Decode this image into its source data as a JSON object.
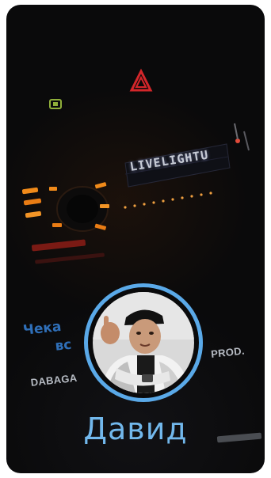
{
  "story": {
    "name": "Давид",
    "radio_display": "LIVELIGHTU",
    "lyrics_line1": "Чека",
    "lyrics_line2": "вс",
    "credit_left": "DABAGA",
    "credit_right": "PROD."
  },
  "colors": {
    "ring": "#5aa9e8",
    "name": "#72b8ec",
    "card_bg": "#0a0a0b",
    "amber_leds": "#f08a1a",
    "hazard_red": "#d3262a",
    "lyrics_blue": "#2f6fb8"
  },
  "icons": {
    "hazard": "hazard-warning-icon",
    "seatbelt": "seatbelt-indicator-icon"
  }
}
